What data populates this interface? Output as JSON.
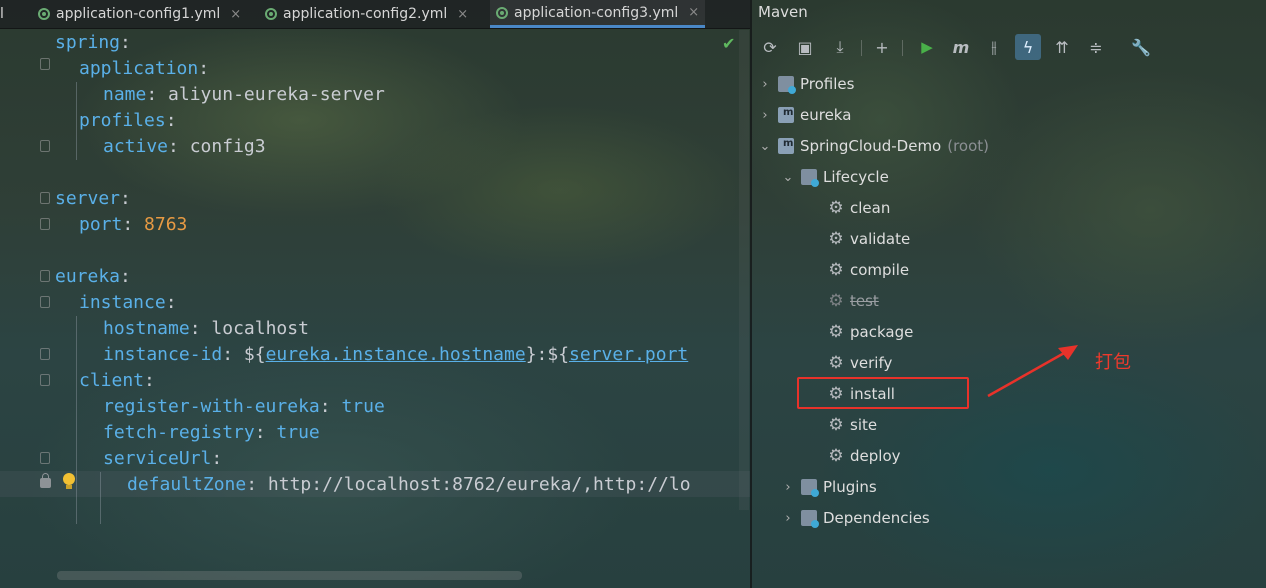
{
  "editor": {
    "tabs": [
      {
        "label": "l",
        "active": false
      },
      {
        "label": "application-config1.yml",
        "active": false
      },
      {
        "label": "application-config2.yml",
        "active": false
      },
      {
        "label": "application-config3.yml",
        "active": true
      }
    ],
    "close_glyph": "×",
    "lines": {
      "l1_key": "spring",
      "l1_colon": ":",
      "l2_key": "application",
      "l2_colon": ":",
      "l3_key": "name",
      "l3_colon": ": ",
      "l3_val": "aliyun-eureka-server",
      "l4_key": "profiles",
      "l4_colon": ":",
      "l5_key": "active",
      "l5_colon": ": ",
      "l5_val": "config3",
      "l7_key": "server",
      "l7_colon": ":",
      "l8_key": "port",
      "l8_colon": ": ",
      "l8_val": "8763",
      "l10_key": "eureka",
      "l10_colon": ":",
      "l11_key": "instance",
      "l11_colon": ":",
      "l12_key": "hostname",
      "l12_colon": ": ",
      "l12_val": "localhost",
      "l13_key": "instance-id",
      "l13_colon": ": ",
      "l13_d1": "${",
      "l13_ref1": "eureka.instance.hostname",
      "l13_mid": "}:${",
      "l13_ref2": "server.port",
      "l14_key": "client",
      "l14_colon": ":",
      "l15_key": "register-with-eureka",
      "l15_colon": ": ",
      "l15_val": "true",
      "l16_key": "fetch-registry",
      "l16_colon": ": ",
      "l16_val": "true",
      "l17_key": "serviceUrl",
      "l17_colon": ":",
      "l18_key": "defaultZone",
      "l18_colon": ": ",
      "l18_val": "http://localhost:8762/eureka/,http://lo"
    }
  },
  "maven": {
    "title": "Maven",
    "toolbar": {
      "reload": "⟳",
      "add": "+",
      "run": "▶",
      "m": "m",
      "toggle": "⫲",
      "offline": "ϟ",
      "skip": "⇈",
      "collapse": "≑",
      "settings": "🔧",
      "download": "⤓",
      "gen": "▣"
    },
    "tree": {
      "profiles": "Profiles",
      "eureka": "eureka",
      "root_project": "SpringCloud-Demo",
      "root_suffix": "(root)",
      "lifecycle": "Lifecycle",
      "goals": [
        "clean",
        "validate",
        "compile",
        "test",
        "package",
        "verify",
        "install",
        "site",
        "deploy"
      ],
      "plugins": "Plugins",
      "dependencies": "Dependencies"
    },
    "annotation": "打包"
  },
  "colors": {
    "key": "#5ab0e8",
    "number": "#e79a43",
    "highlight_box": "#e8322a",
    "run": "#49b049"
  }
}
